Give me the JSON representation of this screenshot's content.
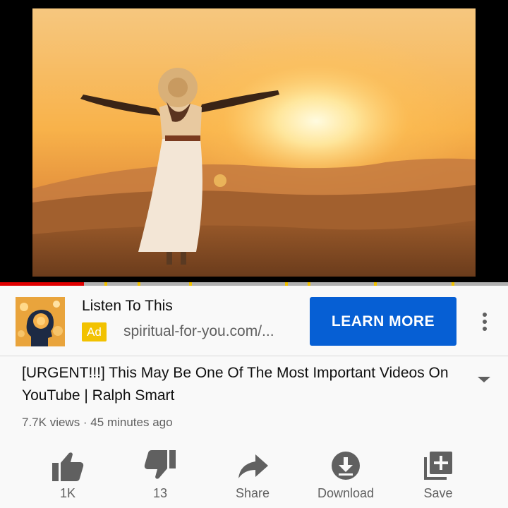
{
  "video": {
    "scene": "sunset-woman-arms-outstretched"
  },
  "progress": {
    "watched_fraction": 0.165,
    "played_color": "#e00000",
    "ad_marker_color": "#f2c200"
  },
  "ad": {
    "title": "Listen To This",
    "badge": "Ad",
    "url": "spiritual-for-you.com/...",
    "cta_label": "LEARN MORE",
    "cta_color": "#065fd4",
    "thumbnail": "glowing-brain-head-image"
  },
  "video_info": {
    "title": "[URGENT!!!] This May Be One Of The Most Important Videos On YouTube | Ralph Smart",
    "meta": "7.7K views · 45 minutes ago"
  },
  "actions": [
    {
      "label": "1K",
      "icon": "thumbs-up-icon"
    },
    {
      "label": "13",
      "icon": "thumbs-down-icon"
    },
    {
      "label": "Share",
      "icon": "share-icon"
    },
    {
      "label": "Download",
      "icon": "download-icon"
    },
    {
      "label": "Save",
      "icon": "save-playlist-icon"
    }
  ]
}
